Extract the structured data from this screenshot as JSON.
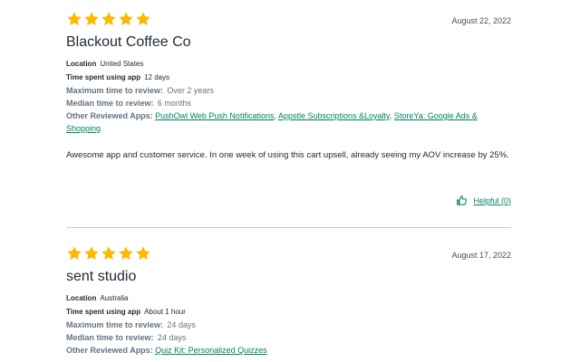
{
  "colors": {
    "star": "#ffb800",
    "link": "#008060",
    "divider": "#c9cccf"
  },
  "icons": {
    "star": "star-icon",
    "helpful": "thumbs-up-icon"
  },
  "reviews": [
    {
      "rating": 5,
      "date": "August 22, 2022",
      "shop": "Blackout Coffee Co",
      "location_label": "Location",
      "location": "United States",
      "time_label": "Time spent using app",
      "time": "12 days",
      "max_label": "Maximum time to review:",
      "max": "Over 2 years",
      "median_label": "Median time to review:",
      "median": "6 months",
      "apps_label": "Other Reviewed Apps:",
      "apps": [
        "PushOwl Web Push Notifications",
        "Appstle Subscriptions &Loyalty",
        "StoreYa: Google Ads & Shopping"
      ],
      "body": "Awesome app and customer service. In one week of using this cart upsell, already seeing my AOV increase by 25%.",
      "helpful": "Helpful (0)"
    },
    {
      "rating": 5,
      "date": "August 17, 2022",
      "shop": "sent studio",
      "location_label": "Location",
      "location": "Australia",
      "time_label": "Time spent using app",
      "time": "About 1 hour",
      "max_label": "Maximum time to review:",
      "max": "24 days",
      "median_label": "Median time to review:",
      "median": "24 days",
      "apps_label": "Other Reviewed Apps:",
      "apps": [
        "Quiz Kit: Personalized Quizzes"
      ]
    }
  ]
}
